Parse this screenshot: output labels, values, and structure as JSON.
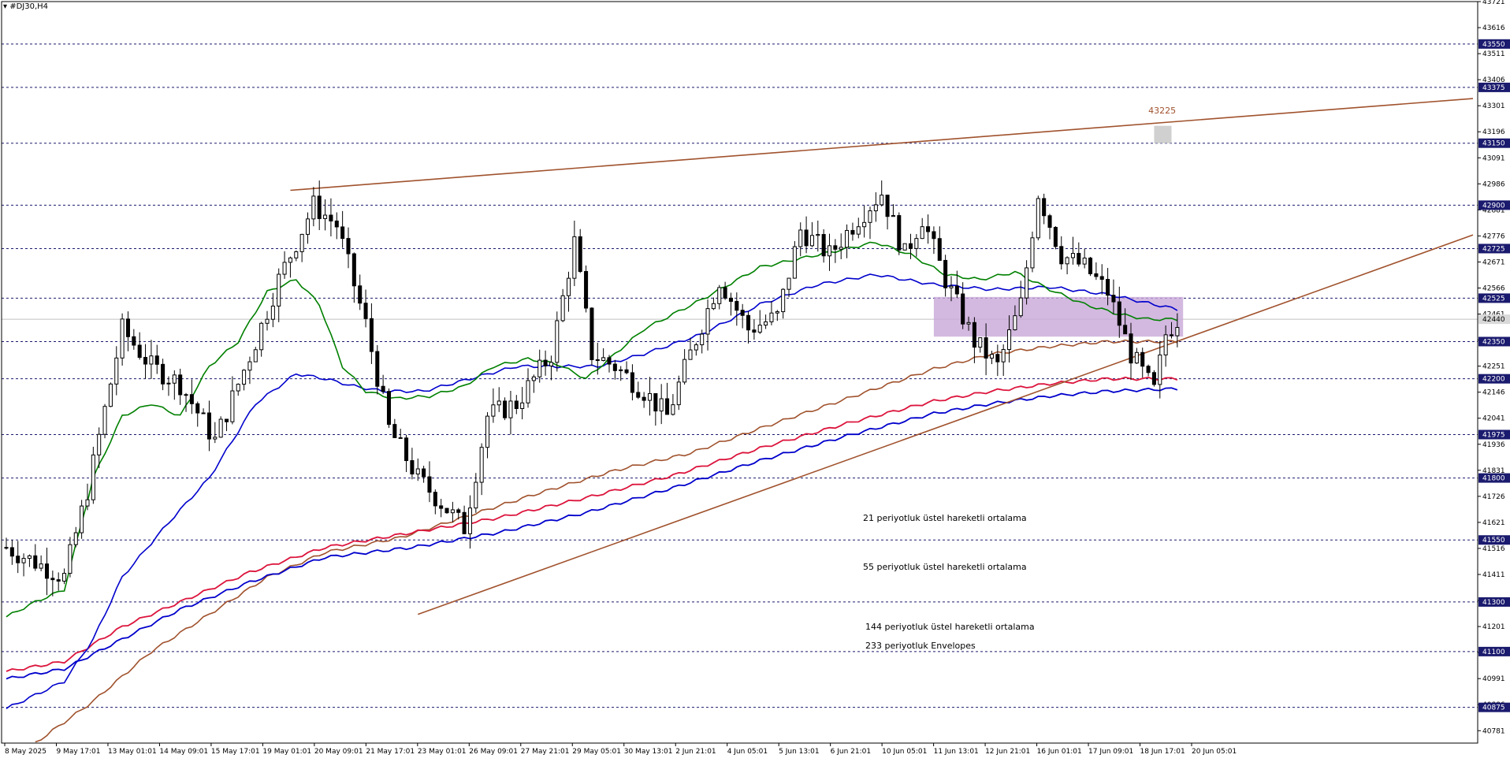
{
  "window": {
    "symbol": "#DJ30,H4"
  },
  "chart_data": {
    "type": "candlestick",
    "symbol": "#DJ30,H4",
    "ylim": [
      40731,
      43721
    ],
    "y_ticks": [
      "43721",
      "43616",
      "43511",
      "43406",
      "43301",
      "43196",
      "43091",
      "42986",
      "42881",
      "42776",
      "42671",
      "42566",
      "42461",
      "42356",
      "42251",
      "42146",
      "42041",
      "41936",
      "41831",
      "41726",
      "41621",
      "41516",
      "41411",
      "41306",
      "41201",
      "41096",
      "40991",
      "40886",
      "40781"
    ],
    "highlighted_levels": [
      {
        "label": "43550",
        "value": 43550
      },
      {
        "label": "43375",
        "value": 43375
      },
      {
        "label": "43150",
        "value": 43150
      },
      {
        "label": "42900",
        "value": 42900
      },
      {
        "label": "42725",
        "value": 42725
      },
      {
        "label": "42525",
        "value": 42525
      },
      {
        "label": "42350",
        "value": 42350
      },
      {
        "label": "42200",
        "value": 42200
      },
      {
        "label": "41975",
        "value": 41975
      },
      {
        "label": "41800",
        "value": 41800
      },
      {
        "label": "41550",
        "value": 41550
      },
      {
        "label": "41300",
        "value": 41300
      },
      {
        "label": "41100",
        "value": 41100
      },
      {
        "label": "40875",
        "value": 40875
      }
    ],
    "current_price": {
      "label": "42440",
      "value": 42440
    },
    "x_labels": [
      "8 May 2025",
      "9 May 17:01",
      "13 May 01:01",
      "14 May 09:01",
      "15 May 17:01",
      "19 May 01:01",
      "20 May 09:01",
      "21 May 17:01",
      "23 May 01:01",
      "26 May 09:01",
      "27 May 21:01",
      "29 May 05:01",
      "30 May 13:01",
      "2 Jun 21:01",
      "4 Jun 05:01",
      "5 Jun 13:01",
      "6 Jun 21:01",
      "10 Jun 05:01",
      "11 Jun 13:01",
      "12 Jun 21:01",
      "16 Jun 01:01",
      "17 Jun 09:01",
      "18 Jun 17:01",
      "20 Jun 05:01"
    ],
    "annotation_level": "43225",
    "legend": [
      {
        "text": "21 periyotluk üstel hareketli ortalama",
        "color": "#008000"
      },
      {
        "text": "55 periyotluk üstel hareketli ortalama",
        "color": "#0000cc"
      },
      {
        "text": "144 periyotluk üstel hareketli ortalama",
        "color": "#a0522d"
      },
      {
        "text": "233 periyotluk Envelopes",
        "color": "#dc143c"
      }
    ],
    "close_anchors": [
      [
        0,
        41520
      ],
      [
        10,
        41400
      ],
      [
        14,
        41750
      ],
      [
        20,
        42400
      ],
      [
        25,
        42250
      ],
      [
        30,
        42180
      ],
      [
        36,
        41950
      ],
      [
        43,
        42350
      ],
      [
        47,
        42600
      ],
      [
        53,
        42900
      ],
      [
        57,
        42820
      ],
      [
        62,
        42420
      ],
      [
        66,
        42000
      ],
      [
        71,
        41800
      ],
      [
        75,
        41700
      ],
      [
        79,
        41600
      ],
      [
        83,
        42050
      ],
      [
        88,
        42100
      ],
      [
        94,
        42300
      ],
      [
        98,
        42750
      ],
      [
        101,
        42300
      ],
      [
        105,
        42250
      ],
      [
        110,
        42150
      ],
      [
        114,
        42050
      ],
      [
        118,
        42300
      ],
      [
        123,
        42600
      ],
      [
        128,
        42400
      ],
      [
        133,
        42450
      ],
      [
        137,
        42800
      ],
      [
        142,
        42700
      ],
      [
        147,
        42850
      ],
      [
        151,
        42950
      ],
      [
        155,
        42700
      ],
      [
        158,
        42850
      ],
      [
        162,
        42600
      ],
      [
        167,
        42350
      ],
      [
        171,
        42250
      ],
      [
        175,
        42500
      ],
      [
        178,
        42950
      ],
      [
        182,
        42700
      ],
      [
        186,
        42650
      ],
      [
        190,
        42550
      ],
      [
        194,
        42300
      ],
      [
        198,
        42150
      ],
      [
        200,
        42380
      ],
      [
        202,
        42440
      ]
    ],
    "ema21_anchors": [
      [
        0,
        41240
      ],
      [
        5,
        41300
      ],
      [
        10,
        41350
      ],
      [
        15,
        41800
      ],
      [
        20,
        42050
      ],
      [
        25,
        42100
      ],
      [
        30,
        42050
      ],
      [
        35,
        42250
      ],
      [
        40,
        42350
      ],
      [
        45,
        42550
      ],
      [
        50,
        42600
      ],
      [
        54,
        42500
      ],
      [
        58,
        42250
      ],
      [
        62,
        42150
      ],
      [
        67,
        42120
      ],
      [
        73,
        42130
      ],
      [
        79,
        42170
      ],
      [
        84,
        42250
      ],
      [
        90,
        42280
      ],
      [
        95,
        42260
      ],
      [
        100,
        42200
      ],
      [
        105,
        42300
      ],
      [
        110,
        42400
      ],
      [
        120,
        42520
      ],
      [
        130,
        42650
      ],
      [
        140,
        42700
      ],
      [
        150,
        42750
      ],
      [
        156,
        42700
      ],
      [
        162,
        42620
      ],
      [
        168,
        42600
      ],
      [
        174,
        42630
      ],
      [
        180,
        42560
      ],
      [
        186,
        42500
      ],
      [
        192,
        42460
      ],
      [
        197,
        42440
      ],
      [
        202,
        42440
      ]
    ],
    "ema55_anchors": [
      [
        0,
        40870
      ],
      [
        10,
        40980
      ],
      [
        15,
        41150
      ],
      [
        20,
        41400
      ],
      [
        28,
        41620
      ],
      [
        35,
        41800
      ],
      [
        43,
        42100
      ],
      [
        50,
        42220
      ],
      [
        55,
        42200
      ],
      [
        60,
        42170
      ],
      [
        65,
        42150
      ],
      [
        72,
        42150
      ],
      [
        80,
        42200
      ],
      [
        88,
        42250
      ],
      [
        95,
        42250
      ],
      [
        102,
        42250
      ],
      [
        110,
        42300
      ],
      [
        120,
        42380
      ],
      [
        130,
        42500
      ],
      [
        140,
        42580
      ],
      [
        150,
        42620
      ],
      [
        160,
        42580
      ],
      [
        170,
        42560
      ],
      [
        180,
        42570
      ],
      [
        190,
        42540
      ],
      [
        196,
        42510
      ],
      [
        202,
        42480
      ]
    ],
    "ema144_anchors": [
      [
        5,
        40731
      ],
      [
        15,
        40900
      ],
      [
        25,
        41100
      ],
      [
        35,
        41250
      ],
      [
        45,
        41400
      ],
      [
        55,
        41500
      ],
      [
        68,
        41560
      ],
      [
        80,
        41650
      ],
      [
        92,
        41740
      ],
      [
        105,
        41830
      ],
      [
        118,
        41900
      ],
      [
        130,
        42000
      ],
      [
        140,
        42080
      ],
      [
        150,
        42160
      ],
      [
        160,
        42240
      ],
      [
        170,
        42300
      ],
      [
        180,
        42330
      ],
      [
        190,
        42350
      ],
      [
        202,
        42350
      ]
    ],
    "env233_anchors": [
      [
        0,
        41020
      ],
      [
        10,
        41060
      ],
      [
        20,
        41200
      ],
      [
        30,
        41300
      ],
      [
        42,
        41420
      ],
      [
        55,
        41520
      ],
      [
        70,
        41580
      ],
      [
        85,
        41640
      ],
      [
        100,
        41720
      ],
      [
        115,
        41810
      ],
      [
        130,
        41920
      ],
      [
        145,
        42020
      ],
      [
        160,
        42110
      ],
      [
        170,
        42150
      ],
      [
        180,
        42180
      ],
      [
        190,
        42200
      ],
      [
        202,
        42200
      ]
    ],
    "ema55_lower_anchors": [
      [
        0,
        40990
      ],
      [
        10,
        41030
      ],
      [
        20,
        41150
      ],
      [
        30,
        41270
      ],
      [
        42,
        41380
      ],
      [
        55,
        41480
      ],
      [
        70,
        41520
      ],
      [
        85,
        41580
      ],
      [
        100,
        41660
      ],
      [
        115,
        41760
      ],
      [
        130,
        41870
      ],
      [
        145,
        41970
      ],
      [
        160,
        42060
      ],
      [
        170,
        42100
      ],
      [
        180,
        42130
      ],
      [
        190,
        42150
      ],
      [
        202,
        42160
      ]
    ],
    "trendlines": [
      {
        "name": "upper-resistance-line",
        "color": "#a0522d",
        "x1": 49,
        "y1": 42960,
        "x2": 253,
        "y2": 43330
      },
      {
        "name": "lower-support-line",
        "color": "#a0522d",
        "x1": 71,
        "y1": 41250,
        "x2": 253,
        "y2": 42780
      }
    ],
    "zone": {
      "name": "consolidation-box",
      "color": "#c8a8d8",
      "x1": 160,
      "x2": 203,
      "y_low": 42370,
      "y_high": 42530
    },
    "gray_marker": {
      "x1": 198,
      "x2": 201,
      "y_low": 43150,
      "y_high": 43220
    }
  }
}
